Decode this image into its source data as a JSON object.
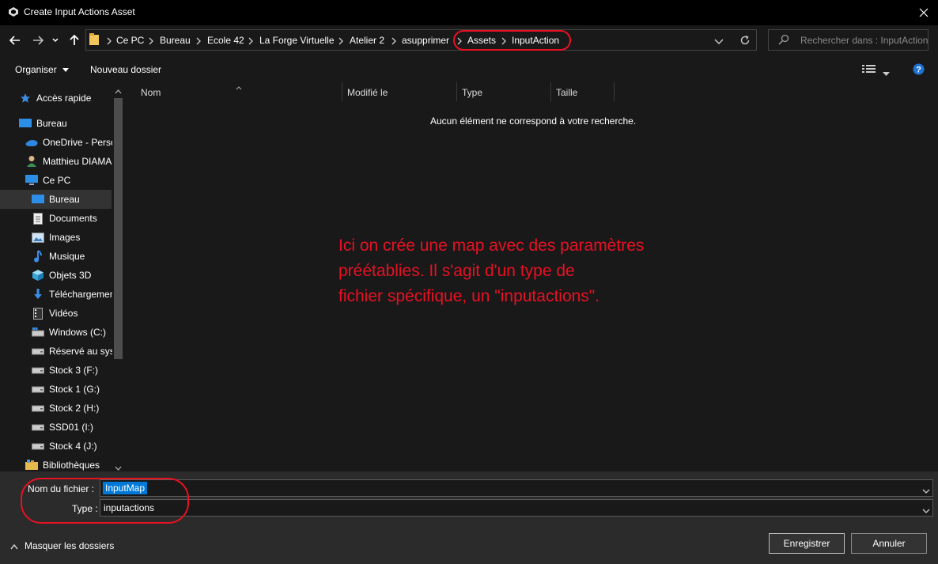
{
  "window": {
    "title": "Create Input Actions Asset",
    "close_icon": "close-icon"
  },
  "breadcrumb": [
    "Ce PC",
    "Bureau",
    "Ecole 42",
    "La Forge Virtuelle",
    "Atelier 2",
    "asupprimer",
    "Assets",
    "InputAction"
  ],
  "search": {
    "placeholder": "Rechercher dans : InputAction"
  },
  "toolbar": {
    "organise_label": "Organiser",
    "new_folder_label": "Nouveau dossier"
  },
  "sidebar": {
    "items": [
      {
        "label": "Accès rapide",
        "icon": "star-icon"
      },
      {
        "label": "Bureau",
        "icon": "desktop-icon"
      },
      {
        "label": "OneDrive - Perso",
        "icon": "cloud-icon"
      },
      {
        "label": "Matthieu DIAMA",
        "icon": "user-icon"
      },
      {
        "label": "Ce PC",
        "icon": "computer-icon"
      },
      {
        "label": "Bureau",
        "icon": "desktop-icon"
      },
      {
        "label": "Documents",
        "icon": "document-icon"
      },
      {
        "label": "Images",
        "icon": "image-icon"
      },
      {
        "label": "Musique",
        "icon": "music-icon"
      },
      {
        "label": "Objets 3D",
        "icon": "cube-icon"
      },
      {
        "label": "Téléchargements",
        "icon": "download-icon"
      },
      {
        "label": "Vidéos",
        "icon": "video-icon"
      },
      {
        "label": "Windows (C:)",
        "icon": "windows-drive-icon"
      },
      {
        "label": "Réservé au système",
        "icon": "drive-icon"
      },
      {
        "label": "Stock 3 (F:)",
        "icon": "drive-icon"
      },
      {
        "label": "Stock 1 (G:)",
        "icon": "drive-icon"
      },
      {
        "label": "Stock 2 (H:)",
        "icon": "drive-icon"
      },
      {
        "label": "SSD01 (I:)",
        "icon": "drive-icon"
      },
      {
        "label": "Stock 4 (J:)",
        "icon": "drive-icon"
      },
      {
        "label": "Bibliothèques",
        "icon": "library-icon"
      }
    ]
  },
  "columns": [
    "Nom",
    "Modifié le",
    "Type",
    "Taille"
  ],
  "empty_message": "Aucun élément ne correspond à votre recherche.",
  "annotation": {
    "lines": [
      "Ici on crée une map avec des paramètres",
      "préétablies. Il s'agit d'un type de",
      "fichier spécifique, un \"inputactions\"."
    ],
    "color": "#e81123"
  },
  "form": {
    "filename_label": "Nom du fichier :",
    "filename_value": "InputMap",
    "type_label": "Type :",
    "type_value": "inputactions"
  },
  "hide_folders_label": "Masquer les dossiers",
  "buttons": {
    "save": "Enregistrer",
    "cancel": "Annuler"
  },
  "colors": {
    "accent": "#0078d7",
    "annotation": "#e81123",
    "selection": "#333333"
  }
}
